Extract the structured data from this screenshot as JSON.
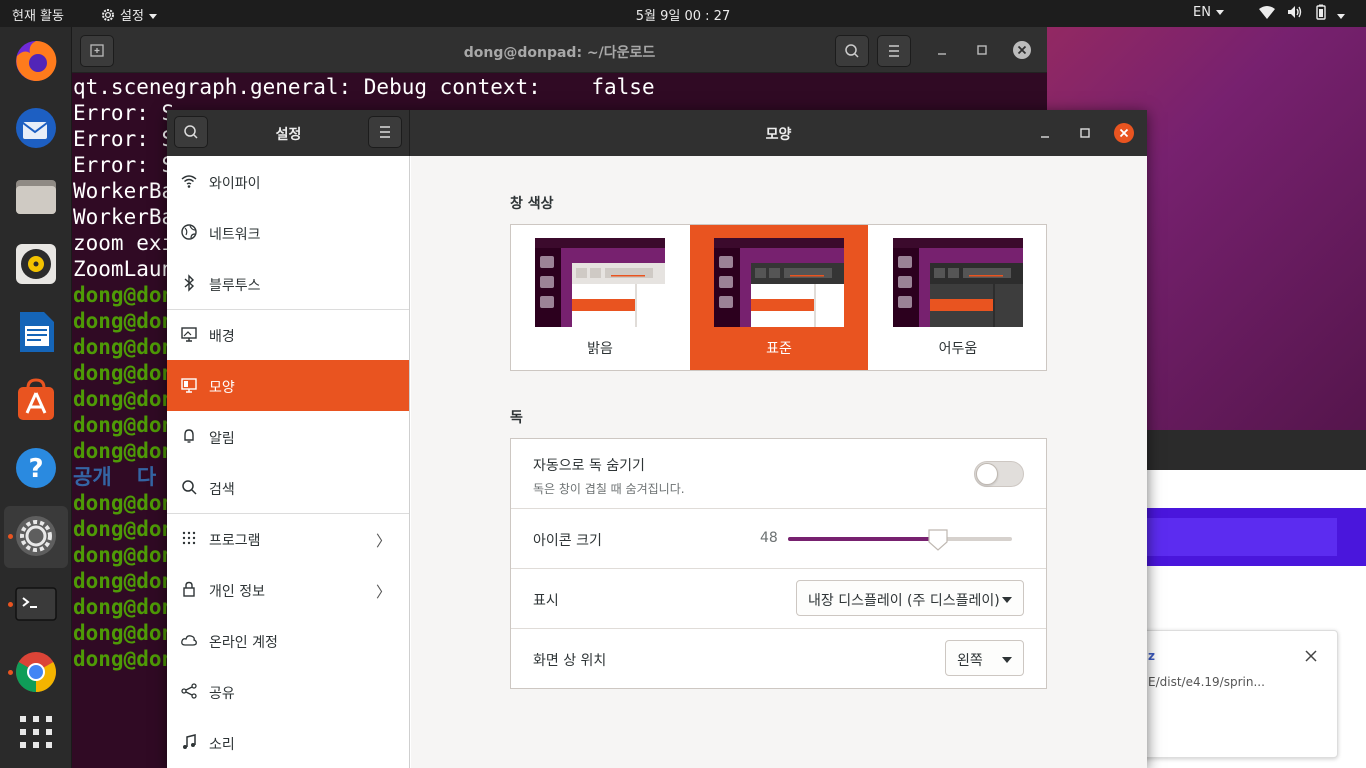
{
  "topbar": {
    "activities": "현재 활동",
    "app_menu": "설정",
    "clock": "5월 9일  00 : 27",
    "input_lang": "EN"
  },
  "dock": {
    "items": [
      {
        "name": "firefox-icon"
      },
      {
        "name": "thunderbird-icon"
      },
      {
        "name": "files-icon"
      },
      {
        "name": "rhythmbox-icon"
      },
      {
        "name": "libreoffice-writer-icon"
      },
      {
        "name": "software-icon"
      },
      {
        "name": "help-icon"
      },
      {
        "name": "settings-icon"
      },
      {
        "name": "terminal-icon"
      },
      {
        "name": "chrome-icon"
      },
      {
        "name": "show-apps-icon"
      }
    ]
  },
  "terminal": {
    "title": "dong@donpad: ~/다운로드",
    "lines": [
      {
        "text": "qt.scenegraph.general: Debug context:    false",
        "style": "normal"
      },
      {
        "text": "Error: S",
        "style": "normal"
      },
      {
        "text": "Error: S",
        "style": "normal"
      },
      {
        "text": "Error: S",
        "style": "normal"
      },
      {
        "text": "WorkerBa",
        "style": "normal"
      },
      {
        "text": "WorkerBa",
        "style": "normal"
      },
      {
        "text": "zoom exi",
        "style": "normal"
      },
      {
        "text": "ZoomLaun",
        "style": "normal"
      },
      {
        "text": "dong@don",
        "style": "prompt"
      },
      {
        "text": "dong@don",
        "style": "prompt"
      },
      {
        "text": "dong@don",
        "style": "prompt"
      },
      {
        "text": "dong@don",
        "style": "prompt"
      },
      {
        "text": "dong@don",
        "style": "prompt"
      },
      {
        "text": "dong@don",
        "style": "prompt"
      },
      {
        "text": "dong@don",
        "style": "prompt"
      },
      {
        "text": "공개  다",
        "style": "blue"
      },
      {
        "text": "dong@don",
        "style": "prompt"
      },
      {
        "text": "dong@don",
        "style": "prompt"
      },
      {
        "text": "dong@don",
        "style": "prompt"
      },
      {
        "text": "dong@don",
        "style": "prompt"
      },
      {
        "text": "dong@don",
        "style": "prompt"
      },
      {
        "text": "dong@don",
        "style": "prompt"
      },
      {
        "text": "dong@don",
        "style": "prompt"
      }
    ]
  },
  "background_window": {
    "link_fragment": "z",
    "path_fragment": "E/dist/e4.19/sprin..."
  },
  "settings": {
    "sidebar_title": "설정",
    "page_title": "모양",
    "sidebar_items": [
      {
        "label": "와이파이",
        "icon": "wifi-icon"
      },
      {
        "label": "네트워크",
        "icon": "network-icon"
      },
      {
        "label": "블루투스",
        "icon": "bluetooth-icon"
      },
      {
        "label": "배경",
        "icon": "background-icon"
      },
      {
        "label": "모양",
        "icon": "appearance-icon"
      },
      {
        "label": "알림",
        "icon": "bell-icon"
      },
      {
        "label": "검색",
        "icon": "search-icon"
      },
      {
        "label": "프로그램",
        "icon": "apps-icon"
      },
      {
        "label": "개인 정보",
        "icon": "lock-icon"
      },
      {
        "label": "온라인 계정",
        "icon": "cloud-icon"
      },
      {
        "label": "공유",
        "icon": "share-icon"
      },
      {
        "label": "소리",
        "icon": "music-note-icon"
      }
    ],
    "active_item": "모양",
    "window_colors": {
      "section_title": "창 색상",
      "options": [
        "밝음",
        "표준",
        "어두움"
      ],
      "selected": "표준"
    },
    "dock": {
      "section_title": "독",
      "autohide_label": "자동으로 독 숨기기",
      "autohide_desc": "독은 창이 겹칠 때 숨겨집니다.",
      "autohide_on": false,
      "icon_size_label": "아이콘 크기",
      "icon_size_value": "48",
      "icon_size_fraction": 0.67,
      "display_label": "표시",
      "display_value": "내장 디스플레이 (주 디스플레이)",
      "position_label": "화면 상 위치",
      "position_value": "왼쪽"
    },
    "accent_color": "#e95420"
  }
}
